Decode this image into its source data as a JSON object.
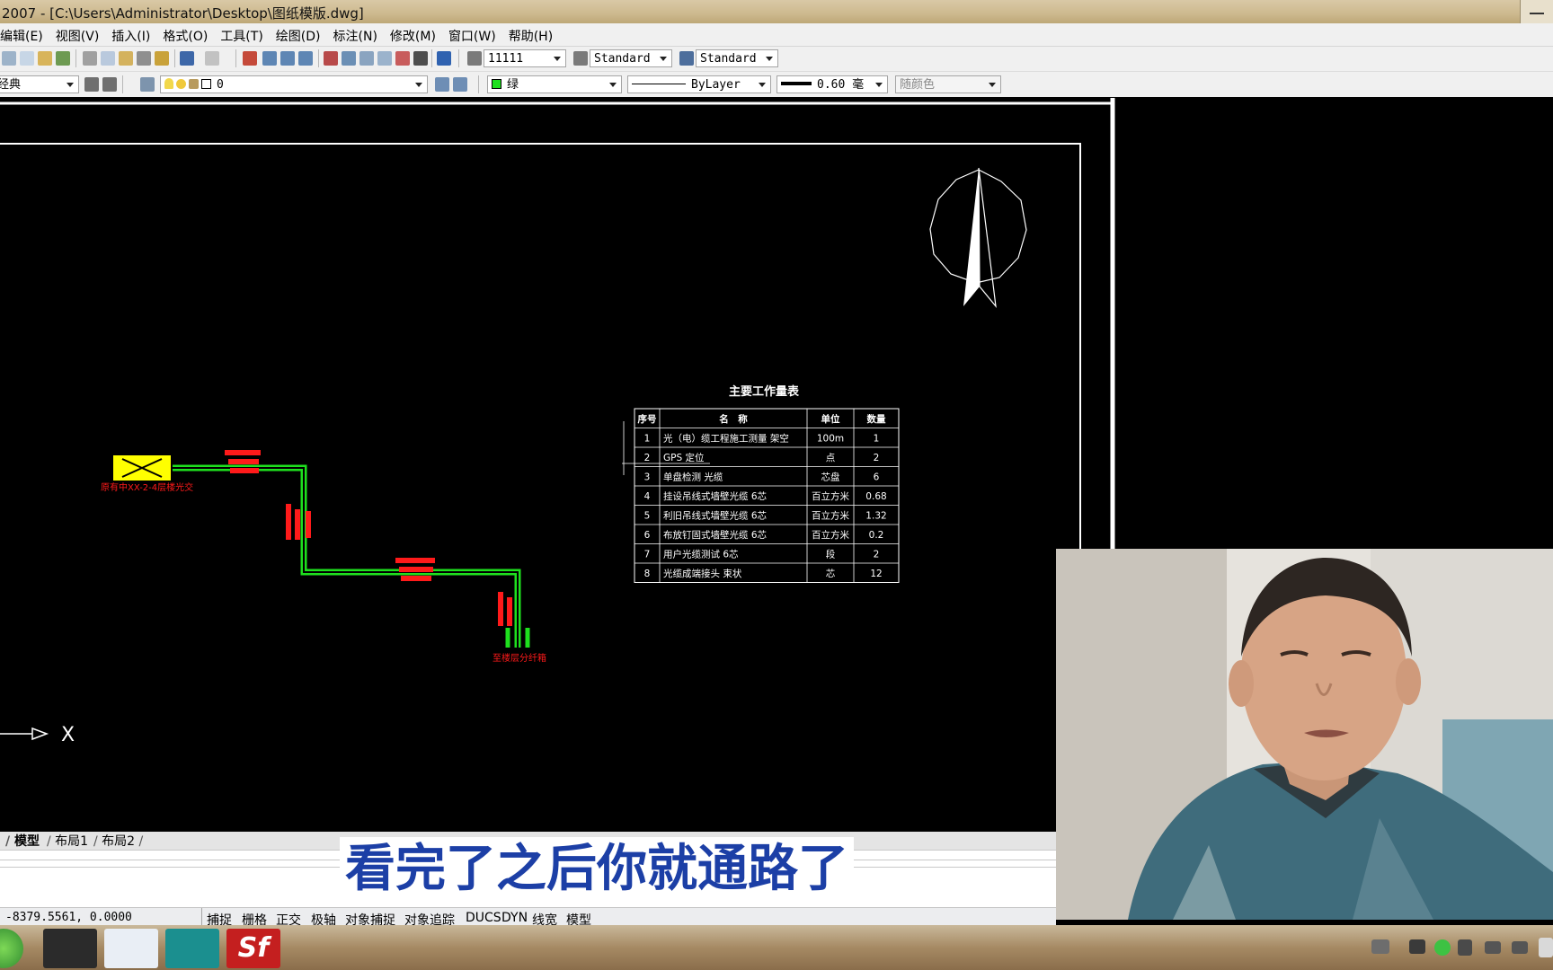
{
  "window": {
    "title": "2007 - [C:\\Users\\Administrator\\Desktop\\图纸模版.dwg]"
  },
  "menu": [
    "编辑(E)",
    "视图(V)",
    "插入(I)",
    "格式(O)",
    "工具(T)",
    "绘图(D)",
    "标注(N)",
    "修改(M)",
    "窗口(W)",
    "帮助(H)"
  ],
  "toolbar1": {
    "text_style": "11111",
    "dim_style": "Standard",
    "table_style": "Standard"
  },
  "toolbar2": {
    "workspace": "经典",
    "layer": "0",
    "color": "绿",
    "linetype": "ByLayer",
    "lineweight": "0.60 毫",
    "plotstyle": "随颜色"
  },
  "drawing": {
    "table_title": "主要工作量表",
    "table_headers": [
      "序号",
      "名　称",
      "单位",
      "数量"
    ],
    "table_rows": [
      [
        "1",
        "光（电）缆工程施工测量 架空",
        "100m",
        "1"
      ],
      [
        "2",
        "GPS 定位",
        "点",
        "2"
      ],
      [
        "3",
        "单盘检测 光缆",
        "芯盘",
        "6"
      ],
      [
        "4",
        "挂设吊线式墙壁光缆 6芯",
        "百立方米",
        "0.68"
      ],
      [
        "5",
        "利旧吊线式墙壁光缆 6芯",
        "百立方米",
        "1.32"
      ],
      [
        "6",
        "布放钉固式墙壁光缆 6芯",
        "百立方米",
        "0.2"
      ],
      [
        "7",
        "用户光缆测试 6芯",
        "段",
        "2"
      ],
      [
        "8",
        "光缆成端接头 束状",
        "芯",
        "12"
      ]
    ],
    "label_start": "原有中XX-2-4层楼光交",
    "label_end": "至楼层分纤箱",
    "axis_label": "X",
    "route_color": "#1ee01e",
    "label_color": "#ff1a1a",
    "box_color": "#ffff00"
  },
  "layout_tabs": [
    "模型",
    "布局1",
    "布局2"
  ],
  "subtitle": "看完了之后你就通路了",
  "status": {
    "coords": "-8379.5561, 0.0000",
    "buttons": [
      "捕捉",
      "栅格",
      "正交",
      "极轴",
      "对象捕捉",
      "对象追踪",
      "DUCS",
      "DYN",
      "线宽",
      "模型"
    ]
  }
}
